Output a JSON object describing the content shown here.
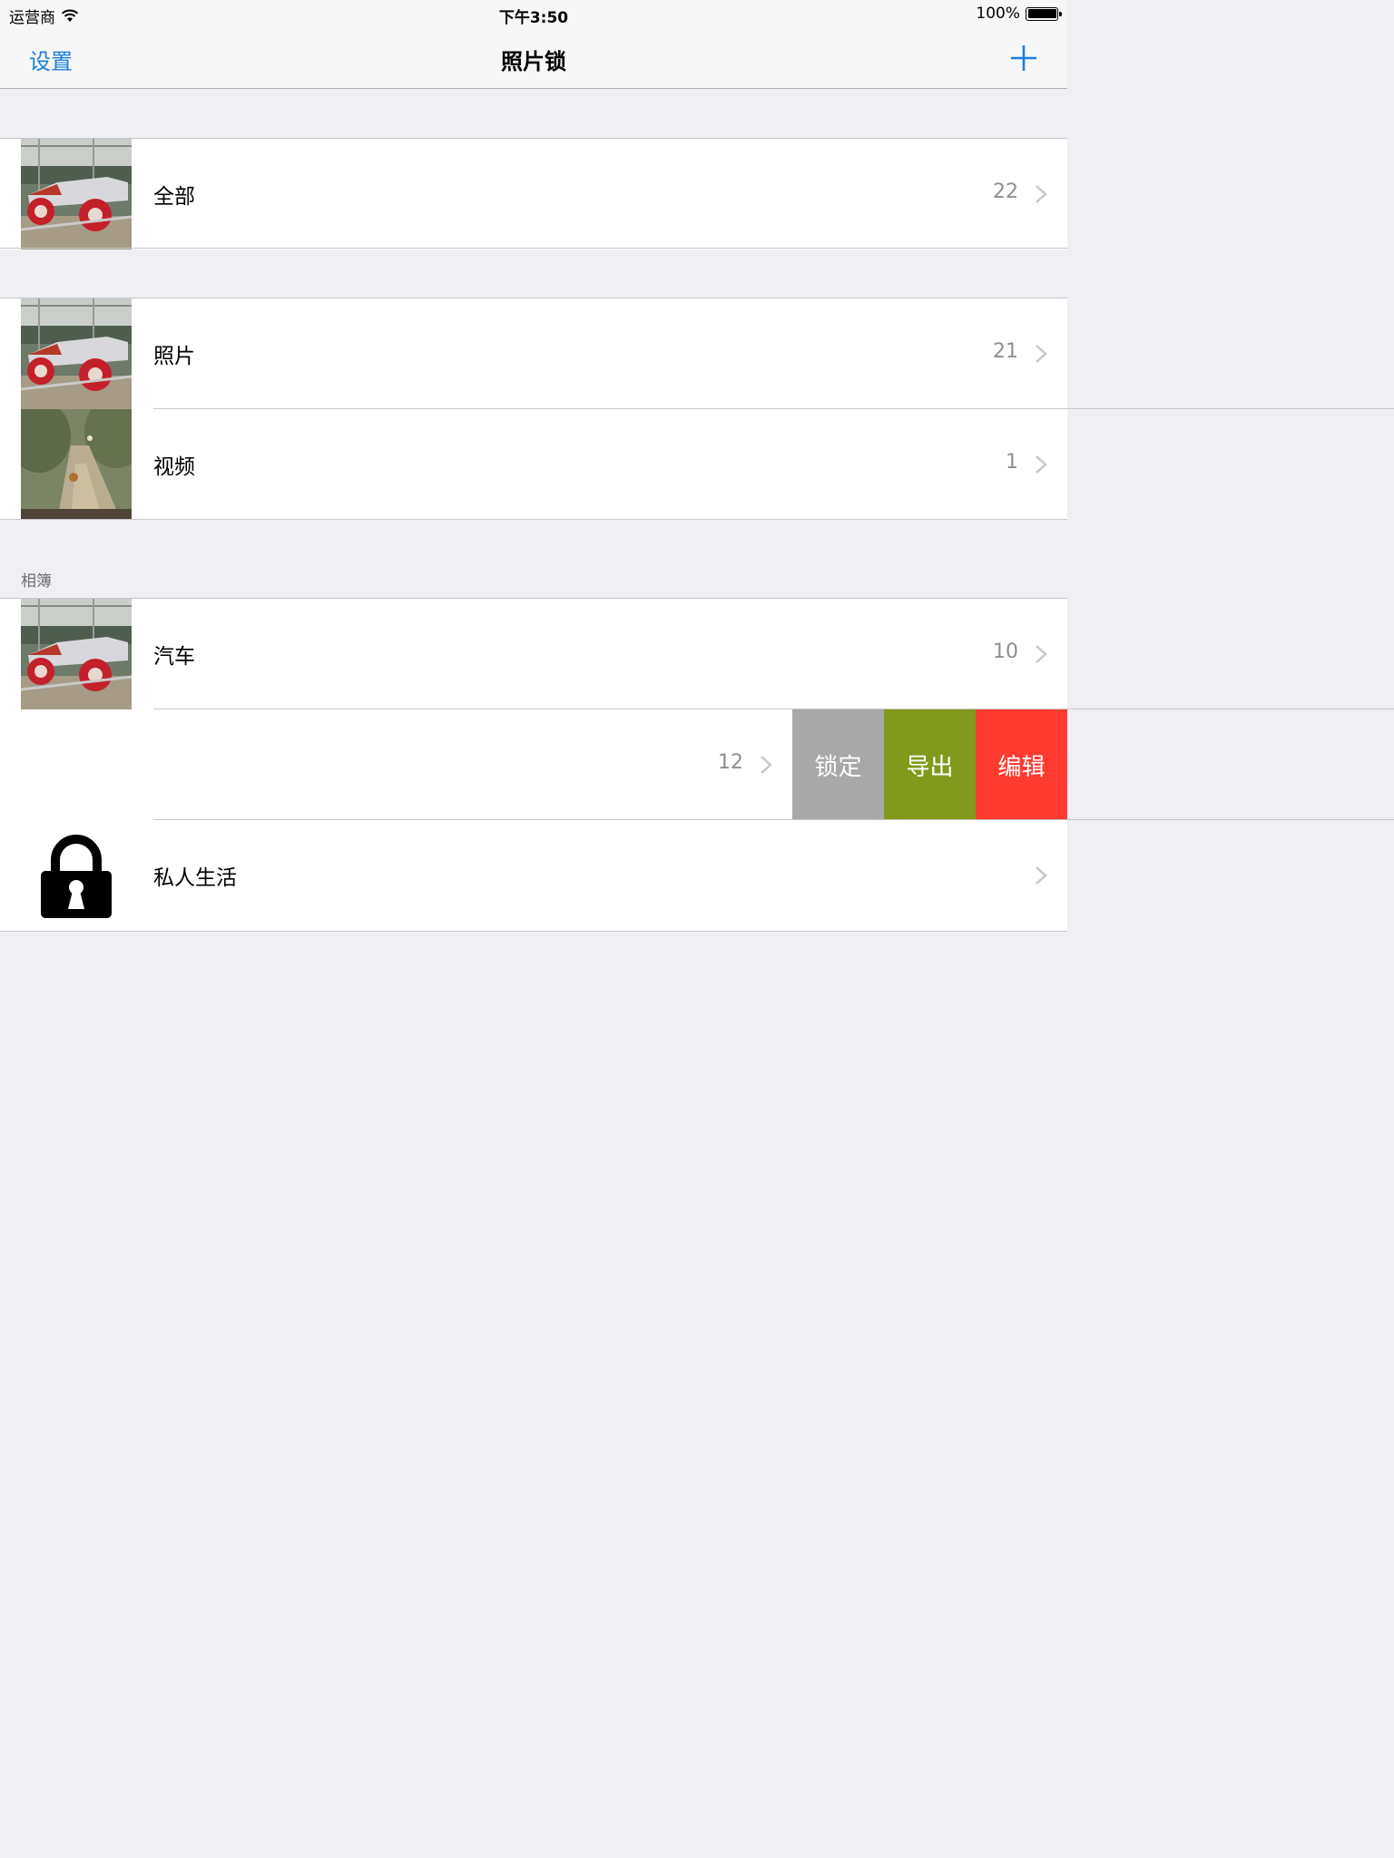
{
  "status_bar": {
    "carrier": "运营商",
    "time": "下午3:50",
    "battery": "100%",
    "battery_level": 1.0
  },
  "nav": {
    "left": "设置",
    "title": "照片锁",
    "add_icon": "plus-icon"
  },
  "rows": {
    "all": {
      "label": "全部",
      "count": "22"
    },
    "photos": {
      "label": "照片",
      "count": "21"
    },
    "videos": {
      "label": "视频",
      "count": "1"
    },
    "cars": {
      "label": "汽车",
      "count": "10"
    },
    "swiped": {
      "count": "12"
    },
    "private": {
      "label": "私人生活"
    }
  },
  "albums_header": "相簿",
  "swipe_actions": {
    "lock": {
      "label": "锁定",
      "color": "#a8a8a8"
    },
    "export": {
      "label": "导出",
      "color": "#819a1c"
    },
    "edit": {
      "label": "编辑",
      "color": "#ff3b30"
    }
  },
  "colors": {
    "accent": "#1a7fdb",
    "background": "#efeff4"
  }
}
